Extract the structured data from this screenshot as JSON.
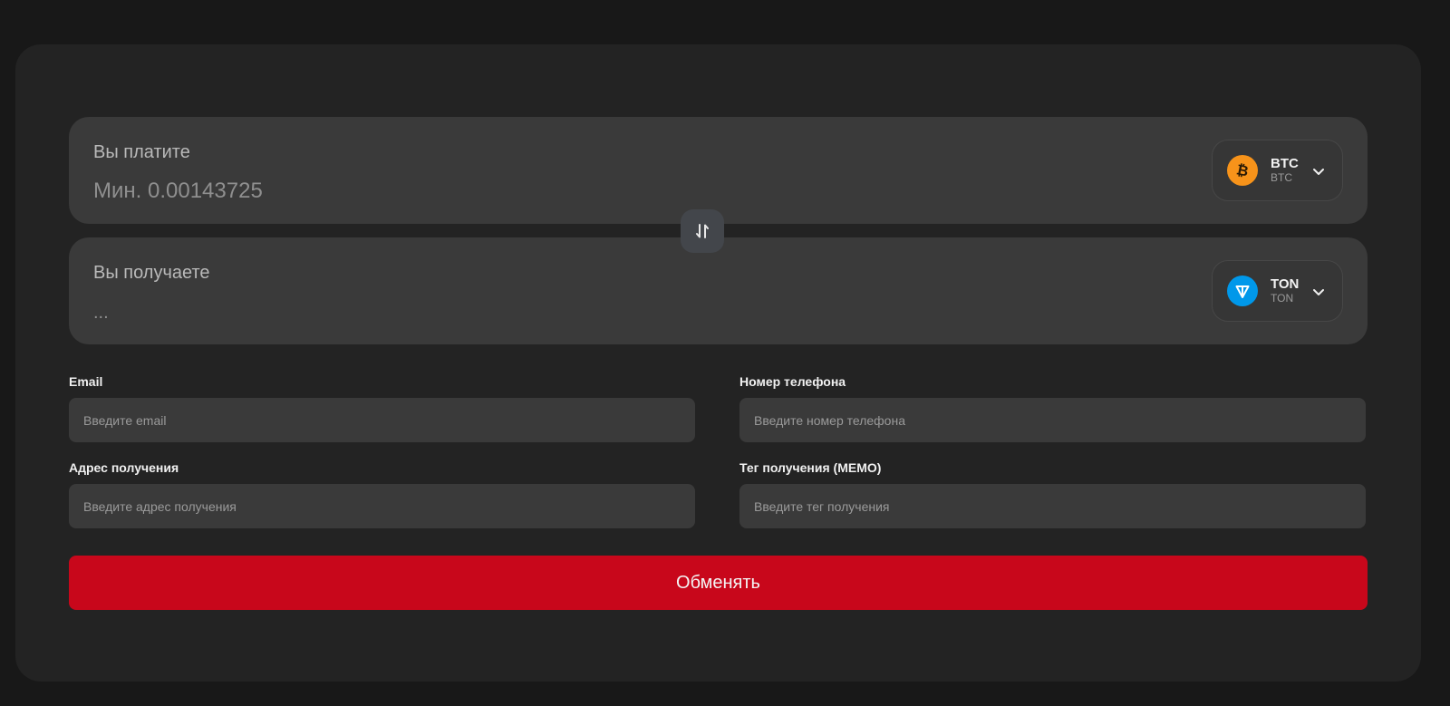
{
  "pay": {
    "label": "Вы платите",
    "value_placeholder": "Мин. 0.00143725",
    "coin": {
      "ticker": "BTC",
      "network": "BTC",
      "icon": "bitcoin-icon",
      "color": "#f7931a"
    }
  },
  "receive": {
    "label": "Вы получаете",
    "value_placeholder": "...",
    "coin": {
      "ticker": "TON",
      "network": "TON",
      "icon": "ton-icon",
      "color": "#0098ea"
    }
  },
  "swap": {
    "icon": "swap-arrows-icon"
  },
  "form": {
    "email": {
      "label": "Email",
      "placeholder": "Введите email"
    },
    "phone": {
      "label": "Номер телефона",
      "placeholder": "Введите номер телефона"
    },
    "address": {
      "label": "Адрес получения",
      "placeholder": "Введите адрес получения"
    },
    "memo": {
      "label": "Тег получения (MEMO)",
      "placeholder": "Введите тег получения"
    }
  },
  "submit": {
    "label": "Обменять",
    "color": "#c8071b"
  }
}
